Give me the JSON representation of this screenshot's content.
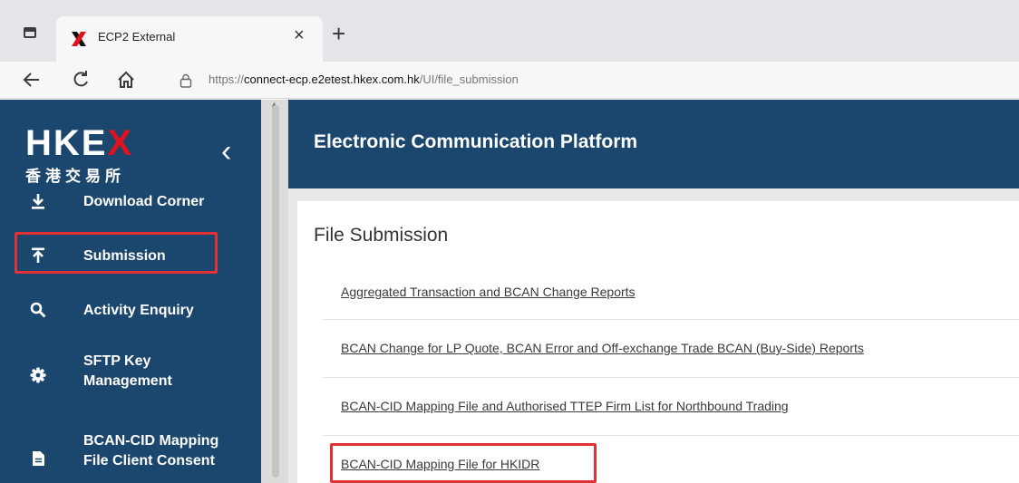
{
  "browser": {
    "tab_title": "ECP2 External",
    "tab_close": "×",
    "new_tab": "+",
    "url_prefix": "https://",
    "url_host": "connect-ecp.e2etest.hkex.com.hk",
    "url_path": "/UI/file_submission",
    "icons": [
      "tab-strip-icon",
      "favicon-icon",
      "back-icon",
      "reload-icon",
      "home-icon",
      "lock-icon"
    ]
  },
  "sidebar": {
    "logo_text_a": "HKE",
    "logo_text_x": "X",
    "logo_sub": "香港交易所",
    "collapse": "‹",
    "items": [
      {
        "label": "Download Corner",
        "icon": "download-icon"
      },
      {
        "label": "Submission",
        "icon": "upload-icon"
      },
      {
        "label": "Activity Enquiry",
        "icon": "search-icon"
      },
      {
        "label": "SFTP Key\nManagement",
        "icon": "gear-icon"
      },
      {
        "label": "BCAN-CID Mapping\nFile Client Consent",
        "icon": "document-icon"
      }
    ]
  },
  "main": {
    "header_title": "Electronic Communication Platform",
    "page_title": "File Submission",
    "links": [
      "Aggregated Transaction and BCAN Change Reports",
      "BCAN Change for LP Quote, BCAN Error and Off-exchange Trade BCAN (Buy-Side) Reports",
      "BCAN-CID Mapping File and Authorised TTEP Firm List for Northbound Trading",
      "BCAN-CID Mapping File for HKIDR"
    ]
  },
  "colors": {
    "brand_navy": "#1b466d",
    "brand_red": "#e0121b",
    "highlight_red": "#e23134"
  }
}
